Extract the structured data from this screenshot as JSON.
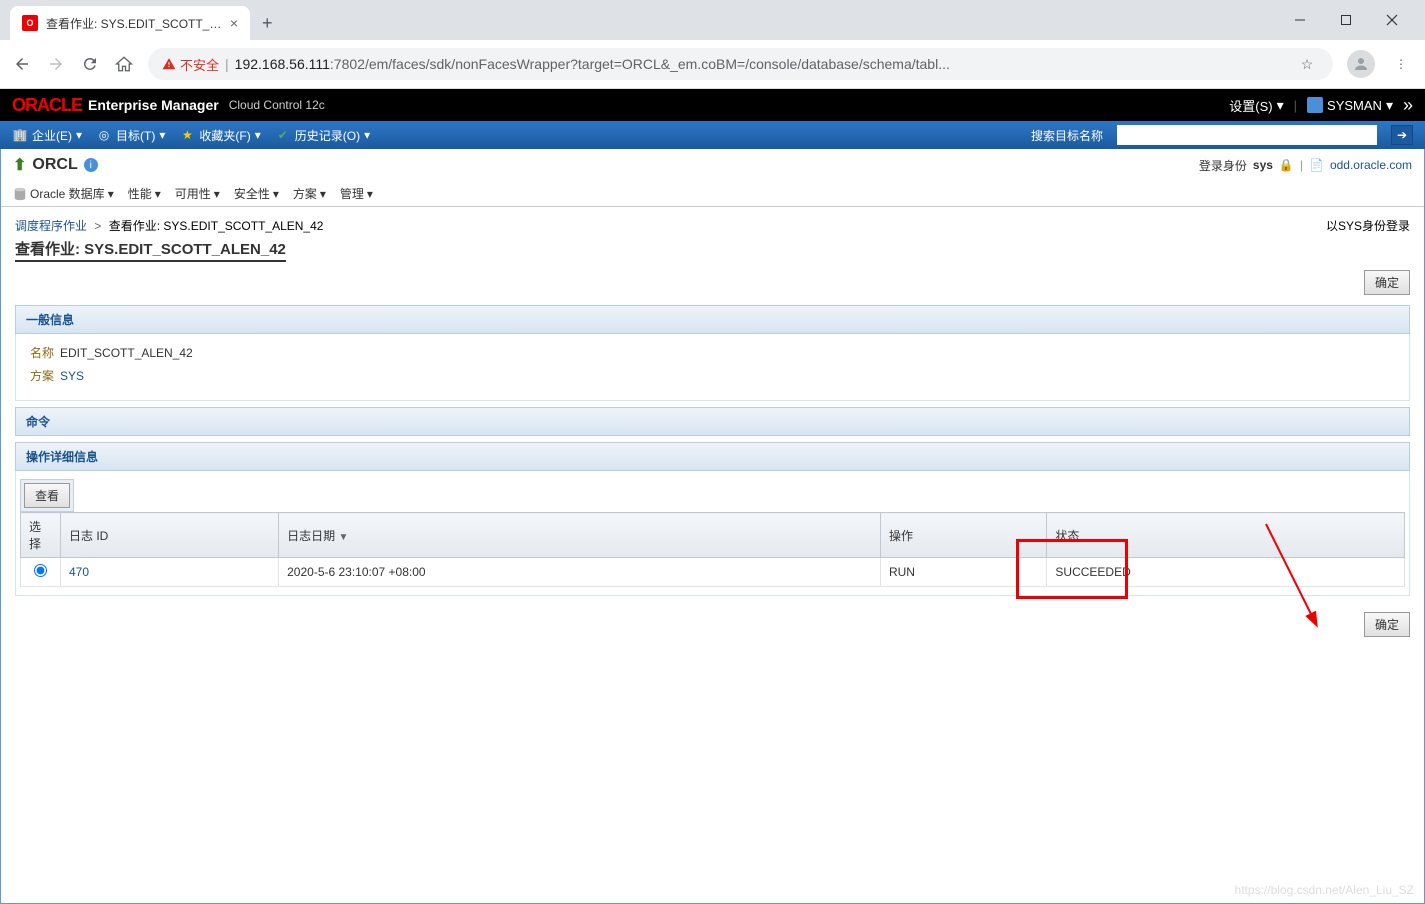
{
  "browser": {
    "tab_title": "查看作业: SYS.EDIT_SCOTT_ALE",
    "insecure_label": "不安全",
    "url_prefix": "192.168.56.111",
    "url_rest": ":7802/em/faces/sdk/nonFacesWrapper?target=ORCL&_em.coBM=/console/database/schema/tabl..."
  },
  "header": {
    "logo": "ORACLE",
    "product": "Enterprise Manager",
    "subproduct": "Cloud Control 12c",
    "settings": "设置(S)",
    "user": "SYSMAN"
  },
  "blue_nav": {
    "items": [
      "企业(E)",
      "目标(T)",
      "收藏夹(F)",
      "历史记录(O)"
    ],
    "search_label": "搜索目标名称"
  },
  "page": {
    "target": "ORCL",
    "login_as_label": "登录身份",
    "login_user": "sys",
    "host_link": "odd.oracle.com",
    "sub_menu": [
      "Oracle 数据库",
      "性能",
      "可用性",
      "安全性",
      "方案",
      "管理"
    ],
    "breadcrumb_link": "调度程序作业",
    "breadcrumb_current": "查看作业: SYS.EDIT_SCOTT_ALEN_42",
    "login_role": "以SYS身份登录",
    "title": "查看作业: SYS.EDIT_SCOTT_ALEN_42",
    "confirm": "确定"
  },
  "sections": {
    "general": {
      "title": "一般信息",
      "name_label": "名称",
      "name_value": "EDIT_SCOTT_ALEN_42",
      "schema_label": "方案",
      "schema_value": "SYS"
    },
    "command": {
      "title": "命令"
    },
    "details": {
      "title": "操作详细信息",
      "view_btn": "查看",
      "columns": [
        "选择",
        "日志 ID",
        "日志日期",
        "操作",
        "状态"
      ],
      "rows": [
        {
          "log_id": "470",
          "log_date": "2020-5-6 23:10:07 +08:00",
          "op": "RUN",
          "status": "SUCCEEDED"
        }
      ]
    }
  },
  "watermark": "https://blog.csdn.net/Alen_Liu_SZ"
}
